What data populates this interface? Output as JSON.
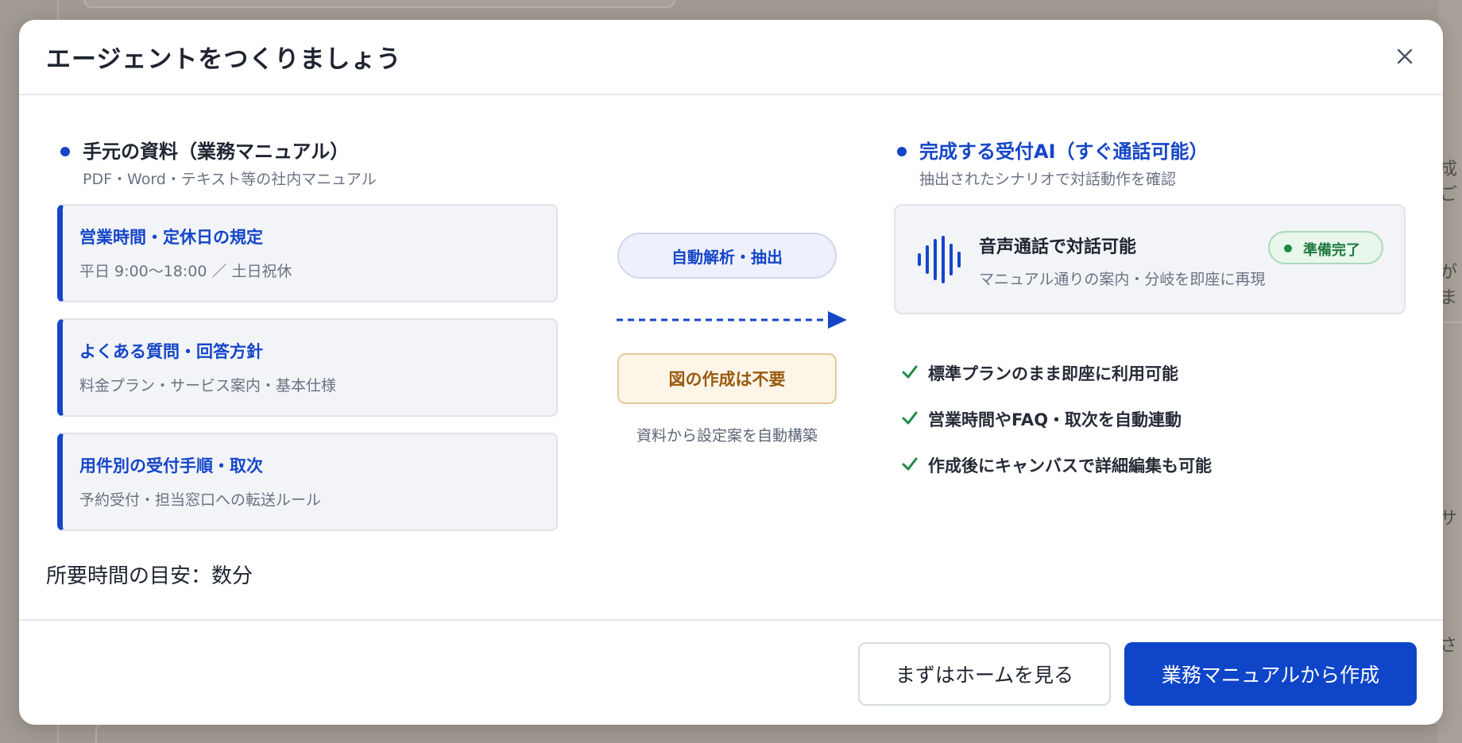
{
  "background": {
    "right_texts": [
      "成ご",
      "がま",
      "サ",
      "さ"
    ]
  },
  "dialog": {
    "title": "エージェントをつくりましょう",
    "close_icon": "close-icon"
  },
  "source": {
    "title": "手元の資料（業務マニュアル）",
    "subtitle": "PDF・Word・テキスト等の社内マニュアル",
    "cards": [
      {
        "title": "営業時間・定休日の規定",
        "subtitle": "平日 9:00〜18:00 ／ 土日祝休"
      },
      {
        "title": "よくある質問・回答方針",
        "subtitle": "料金プラン・サービス案内・基本仕様"
      },
      {
        "title": "用件別の受付手順・取次",
        "subtitle": "予約受付・担当窓口への転送ルール"
      }
    ]
  },
  "middle": {
    "auto_label": "自動解析・抽出",
    "no_diagram_label": "図の作成は不要",
    "note": "資料から設定案を自動構築"
  },
  "result": {
    "title": "完成する受付AI（すぐ通話可能）",
    "subtitle": "抽出されたシナリオで対話動作を確認",
    "voice_card": {
      "title": "音声通話で対話可能",
      "subtitle": "マニュアル通りの案内・分岐を即座に再現",
      "badge": "準備完了"
    },
    "checks": [
      "標準プランのまま即座に利用可能",
      "営業時間やFAQ・取次を自動連動",
      "作成後にキャンバスで詳細編集も可能"
    ]
  },
  "time_note": "所要時間の目安：数分",
  "footer": {
    "secondary_label": "まずはホームを見る",
    "primary_label": "業務マニュアルから作成"
  },
  "colors": {
    "accent": "#1546c8",
    "primary_button": "#0f45c8",
    "badge_green": "#1f8a45",
    "warning_text": "#9a5a10"
  }
}
